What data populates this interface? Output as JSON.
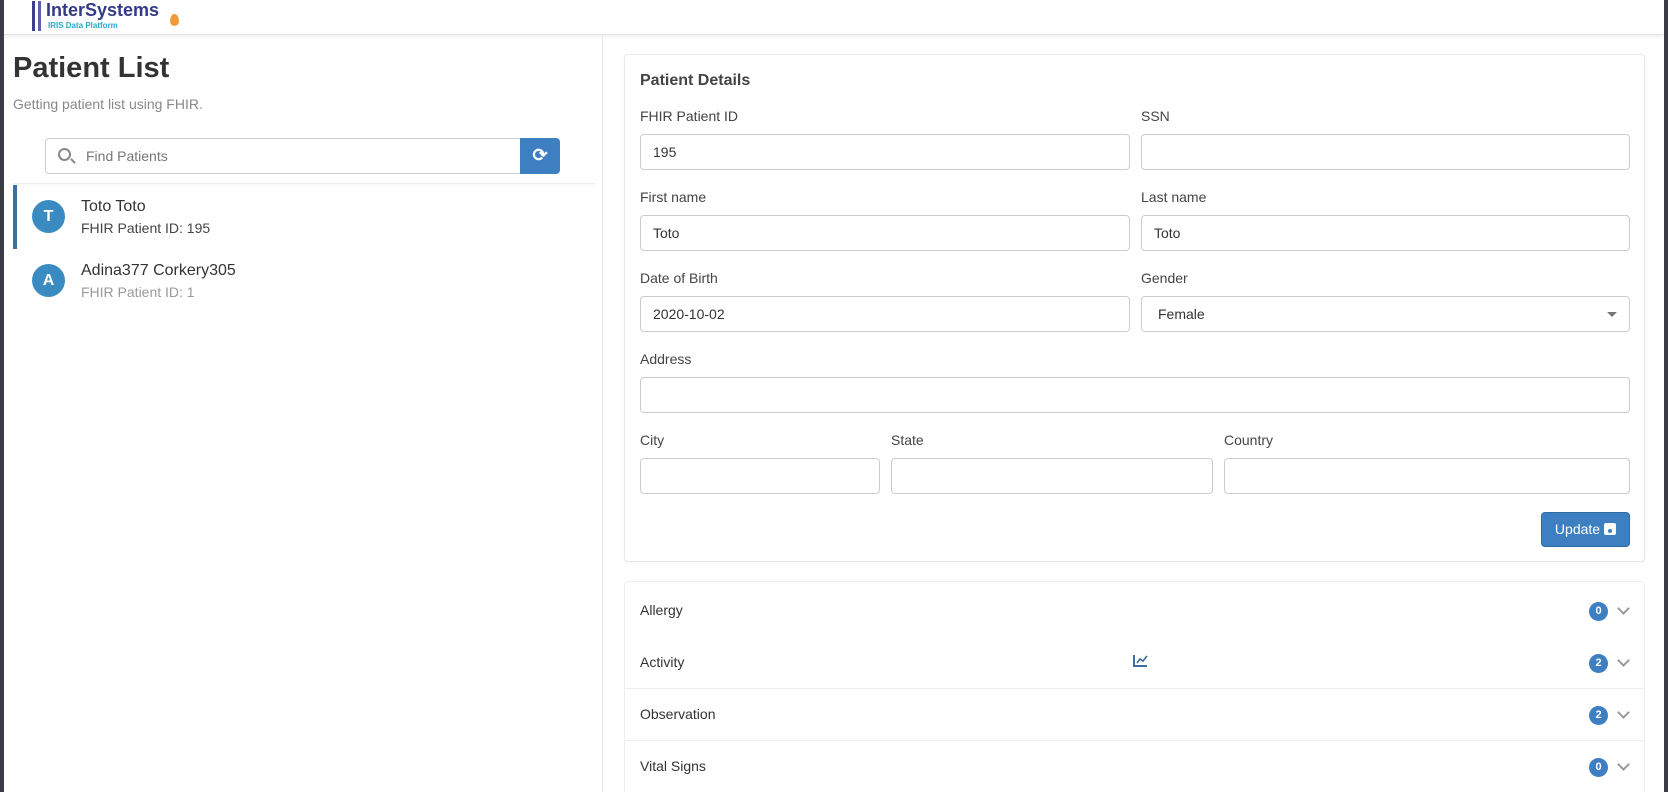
{
  "header": {
    "logo_text": "InterSystems",
    "logo_sub": "IRIS Data Platform"
  },
  "patient_list": {
    "title": "Patient List",
    "subtitle": "Getting patient list using FHIR.",
    "search_placeholder": "Find Patients",
    "refresh_icon": "refresh-icon",
    "items": [
      {
        "initial": "T",
        "name": "Toto Toto",
        "id_label": "FHIR Patient ID: 195",
        "active": true
      },
      {
        "initial": "A",
        "name": "Adina377 Corkery305",
        "id_label": "FHIR Patient ID: 1",
        "active": false
      }
    ]
  },
  "details": {
    "title": "Patient Details",
    "fields": {
      "fhir_id": {
        "label": "FHIR Patient ID",
        "value": "195"
      },
      "ssn": {
        "label": "SSN",
        "value": ""
      },
      "first_name": {
        "label": "First name",
        "value": "Toto"
      },
      "last_name": {
        "label": "Last name",
        "value": "Toto"
      },
      "dob": {
        "label": "Date of Birth",
        "value": "2020-10-02"
      },
      "gender": {
        "label": "Gender",
        "value": "Female"
      },
      "address": {
        "label": "Address",
        "value": ""
      },
      "city": {
        "label": "City",
        "value": ""
      },
      "state": {
        "label": "State",
        "value": ""
      },
      "country": {
        "label": "Country",
        "value": ""
      }
    },
    "update_label": "Update"
  },
  "sections": [
    {
      "label": "Allergy",
      "count": "0"
    },
    {
      "label": "Activity",
      "count": "2",
      "icon": "chart-line-icon"
    },
    {
      "label": "Observation",
      "count": "2"
    },
    {
      "label": "Vital Signs",
      "count": "0"
    }
  ],
  "colors": {
    "primary": "#3d7fc1",
    "avatar": "#3a8bc2"
  }
}
